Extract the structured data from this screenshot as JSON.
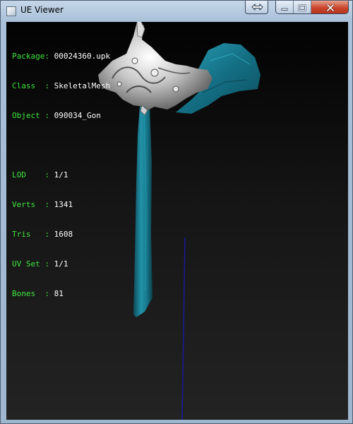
{
  "window": {
    "title": "UE Viewer",
    "icons": {
      "restore": "double-arrow-icon",
      "minimize": "minimize-icon",
      "maximize": "maximize-icon",
      "close": "close-icon"
    }
  },
  "info": {
    "package_key": "Package: ",
    "package": "00024360.upk",
    "class_key": "Class  : ",
    "class": "SkeletalMesh",
    "object_key": "Object : ",
    "object": "090034_Gon",
    "lod_key": "LOD    : ",
    "lod": "1/1",
    "verts_key": "Verts  : ",
    "verts": "1341",
    "tris_key": "Tris   : ",
    "tris": "1608",
    "uvset_key": "UV Set : ",
    "uvset": "1/1",
    "bones_key": "Bones  : ",
    "bones": "81"
  },
  "colors": {
    "label": "#3ee63e",
    "value": "#ffffff",
    "cloth": "#1d7e93",
    "metal": "#d7d7d7",
    "bone_line": "#1a1a9a"
  }
}
